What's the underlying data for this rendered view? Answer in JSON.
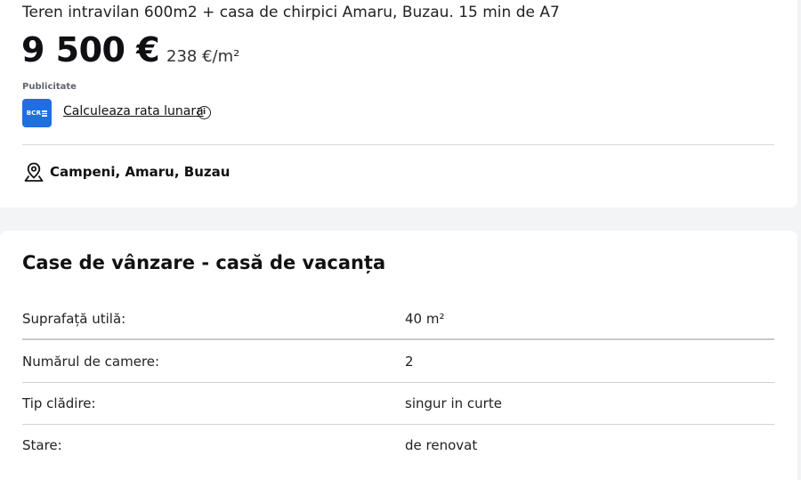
{
  "listing": {
    "title": "Teren intravilan 600m2 + casa de chirpici Amaru, Buzau. 15 min de A7",
    "price": "9 500 €",
    "price_per_m2": "238 €/m²",
    "ad_label": "Publicitate",
    "bank_logo_text": "BCR",
    "rate_link": "Calculeaza rata lunara",
    "info_icon_glyph": "i",
    "location": "Campeni, Amaru, Buzau"
  },
  "details": {
    "section_title": "Case de vânzare - casă de vacanța",
    "rows": [
      {
        "label": "Suprafață utilă:",
        "value": "40 m²"
      },
      {
        "label": "Numărul de camere:",
        "value": "2"
      },
      {
        "label": "Tip clădire:",
        "value": "singur in curte"
      },
      {
        "label": "Stare:",
        "value": "de renovat"
      }
    ]
  },
  "icons": {
    "info": "info-circle-icon",
    "location": "map-pin-icon"
  },
  "colors": {
    "bank_brand": "#1f6fe0",
    "page_background": "#f2f4f5"
  }
}
